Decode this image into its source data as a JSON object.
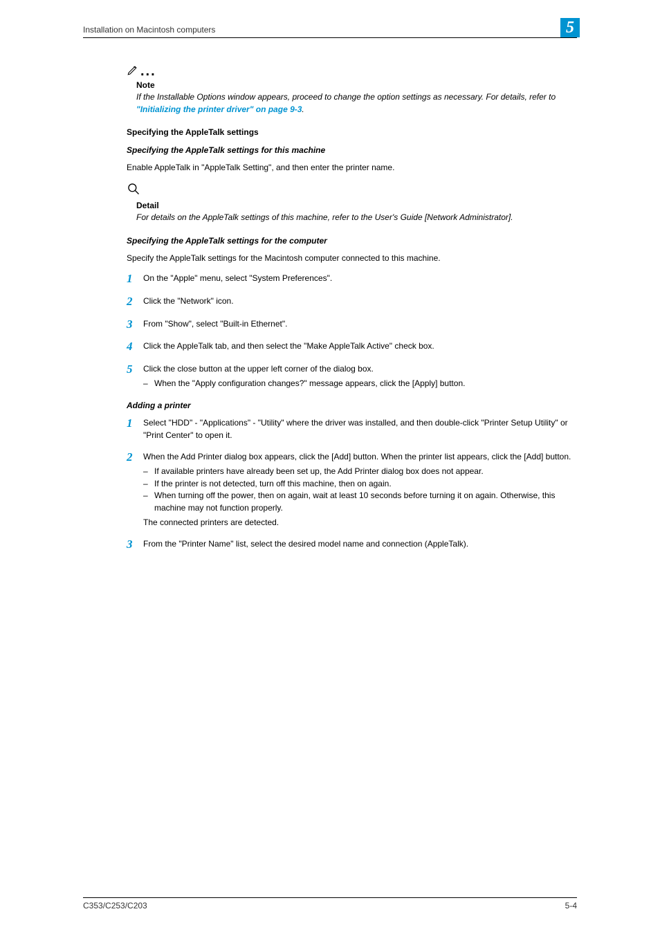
{
  "header": {
    "text": "Installation on Macintosh computers"
  },
  "section_number": "5",
  "note": {
    "label": "Note",
    "text_before": "If the Installable Options window appears, proceed to change the option settings as necessary. For details, refer to ",
    "link": "\"Initializing the printer driver\" on page 9-3",
    "text_after": "."
  },
  "h1": "Specifying the AppleTalk settings",
  "h2a": "Specifying the AppleTalk settings for this machine",
  "p1": "Enable AppleTalk in \"AppleTalk Setting\", and then enter the printer name.",
  "detail": {
    "label": "Detail",
    "text": "For details on the AppleTalk settings of this machine, refer to the User's Guide [Network Administrator]."
  },
  "h2b": "Specifying the AppleTalk settings for the computer",
  "p2": "Specify the AppleTalk settings for the Macintosh computer connected to this machine.",
  "steps_a": {
    "1": "On the \"Apple\" menu, select \"System Preferences\".",
    "2": "Click the \"Network\" icon.",
    "3": "From \"Show\", select \"Built-in Ethernet\".",
    "4": "Click the AppleTalk tab, and then select the \"Make AppleTalk Active\" check box.",
    "5": "Click the close button at the upper left corner of the dialog box.",
    "5_sub1": "When the \"Apply configuration changes?\" message appears, click the [Apply] button."
  },
  "h2c": "Adding a printer",
  "steps_b": {
    "1": "Select \"HDD\" - \"Applications\" - \"Utility\" where the driver was installed, and then double-click \"Printer Setup Utility\" or \"Print Center\" to open it.",
    "2": "When the Add Printer dialog box appears, click the [Add] button. When the printer list appears, click the [Add] button.",
    "2_sub1": "If available printers have already been set up, the Add Printer dialog box does not appear.",
    "2_sub2": "If the printer is not detected, turn off this machine, then on again.",
    "2_sub3": "When turning off the power, then on again, wait at least 10 seconds before turning it on again. Otherwise, this machine may not function properly.",
    "2_after": "The connected printers are detected.",
    "3": "From the \"Printer Name\" list, select the desired model name and connection (AppleTalk)."
  },
  "footer": {
    "left": "C353/C253/C203",
    "right": "5-4"
  }
}
